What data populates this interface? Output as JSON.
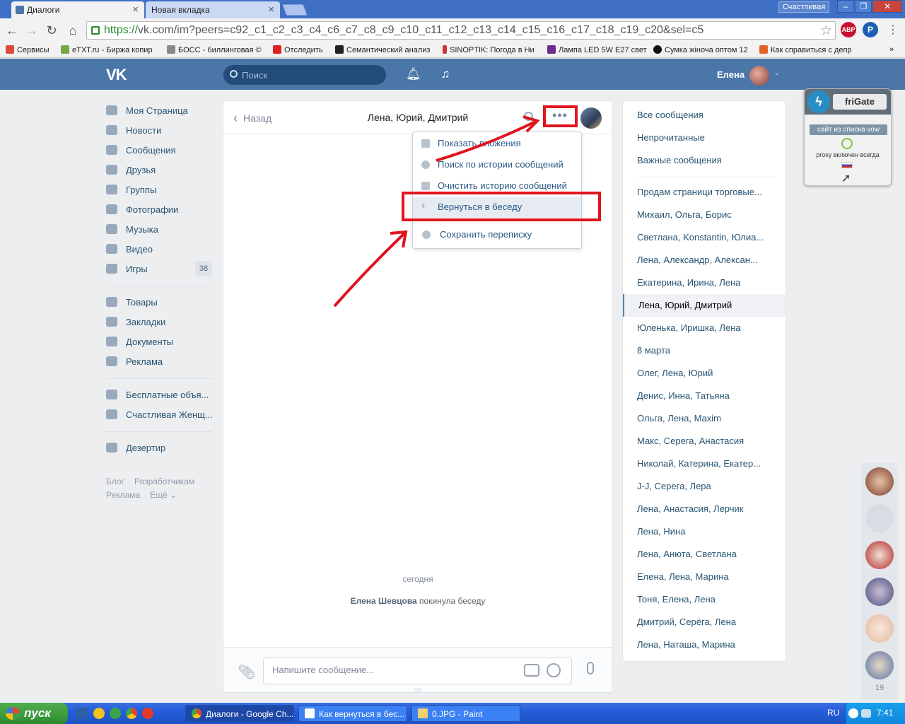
{
  "browser": {
    "tabs": [
      {
        "title": "Диалоги",
        "active": true
      },
      {
        "title": "Новая вкладка",
        "active": false
      }
    ],
    "profile": "Счастливая",
    "url_scheme": "https://",
    "url_rest": "vk.com/im?peers=c92_c1_c2_c3_c4_c6_c7_c8_c9_c10_c11_c12_c13_c14_c15_c16_c17_c18_c19_c20&sel=c5",
    "bookmarks": [
      "Сервисы",
      "eTXT.ru - Биржа копир",
      "БОСС - биллинговая ©",
      "Отследить",
      "Семантический анализ",
      "SINOPTIK: Погода в Ни",
      "Лампа LED 5W E27 свет",
      "Сумка жіноча оптом 12",
      "Как справиться с депр"
    ]
  },
  "header": {
    "logo": "VK",
    "search_placeholder": "Поиск",
    "user_name": "Елена"
  },
  "left_menu": {
    "group1": [
      {
        "label": "Моя Страница",
        "icon": "home-icon"
      },
      {
        "label": "Новости",
        "icon": "news-icon"
      },
      {
        "label": "Сообщения",
        "icon": "messages-icon"
      },
      {
        "label": "Друзья",
        "icon": "friends-icon"
      },
      {
        "label": "Группы",
        "icon": "groups-icon"
      },
      {
        "label": "Фотографии",
        "icon": "camera-icon"
      },
      {
        "label": "Музыка",
        "icon": "music-icon"
      },
      {
        "label": "Видео",
        "icon": "video-icon"
      },
      {
        "label": "Игры",
        "icon": "gamepad-icon",
        "badge": "38"
      }
    ],
    "group2": [
      {
        "label": "Товары",
        "icon": "bag-icon"
      },
      {
        "label": "Закладки",
        "icon": "star-icon"
      },
      {
        "label": "Документы",
        "icon": "document-icon"
      },
      {
        "label": "Реклама",
        "icon": "megaphone-icon"
      }
    ],
    "group3": [
      {
        "label": "Бесплатные объя...",
        "icon": "group-icon"
      },
      {
        "label": "Счастливая Женщ...",
        "icon": "group-icon"
      }
    ],
    "group4": [
      {
        "label": "Дезертир",
        "icon": "apps-icon"
      }
    ],
    "footer": {
      "blog": "Блог",
      "devs": "Разработчикам",
      "ads": "Реклама",
      "more": "Ещё ⌄"
    }
  },
  "chat": {
    "back_label": "Назад",
    "title": "Лена, Юрий, Дмитрий",
    "more_label": "•••",
    "date_separator": "сегодня",
    "system_author": "Елена Шевцова",
    "system_text": " покинула беседу",
    "input_placeholder": "Напишите сообщение..."
  },
  "dropdown": {
    "items": [
      {
        "label": "Показать вложения",
        "icon": "paperclip-icon"
      },
      {
        "label": "Поиск по истории сообщений",
        "icon": "search-icon"
      },
      {
        "label": "Очистить историю сообщений",
        "icon": "trash-icon"
      },
      {
        "label": "Вернуться в беседу",
        "icon": "chevron-left-icon"
      },
      {
        "label": "Сохранить переписку",
        "icon": "gear-icon"
      }
    ]
  },
  "right_panel": {
    "filters": [
      "Все сообщения",
      "Непрочитанные",
      "Важные сообщения"
    ],
    "conversations": [
      "Продам страници торговые...",
      "Михаил, Ольга, Борис",
      "Светлана, Konstantin, Юлиа...",
      "Лена, Александр, Алексан...",
      "Екатерина, Ирина, Лена",
      "Лена, Юрий, Дмитрий",
      "Юленька, Иришка, Лена",
      "8 марта",
      "Олег, Лена, Юрий",
      "Денис, Инна, Татьяна",
      "Ольга, Лена, Maxim",
      "Макс, Серега, Анастасия",
      "Николай, Катерина, Екатер...",
      "J-J, Серега, Лера",
      "Лена, Анастасия, Лерчик",
      "Лена, Нина",
      "Лена, Анюта, Светлана",
      "Елена, Лена, Марина",
      "Тоня, Елена, Лена",
      "Дмитрий, Серёга, Лена",
      "Лена, Наташа, Марина"
    ],
    "selected": "Лена, Юрий, Дмитрий"
  },
  "frigate": {
    "name": "friGate",
    "tag": "сайт из списка vow",
    "status": "proxy включен всегда"
  },
  "avatar_strip": {
    "count": "19"
  },
  "taskbar": {
    "start": "пуск",
    "tasks": [
      {
        "label": "Диалоги - Google Ch...",
        "active": true
      },
      {
        "label": "Как вернуться в бес...",
        "active": false
      },
      {
        "label": "0.JPG - Paint",
        "active": false
      }
    ],
    "lang": "RU",
    "time": "7:41"
  },
  "colors": {
    "vk_blue": "#4a76a8",
    "link": "#285473",
    "annotation_red": "#e0141e"
  }
}
